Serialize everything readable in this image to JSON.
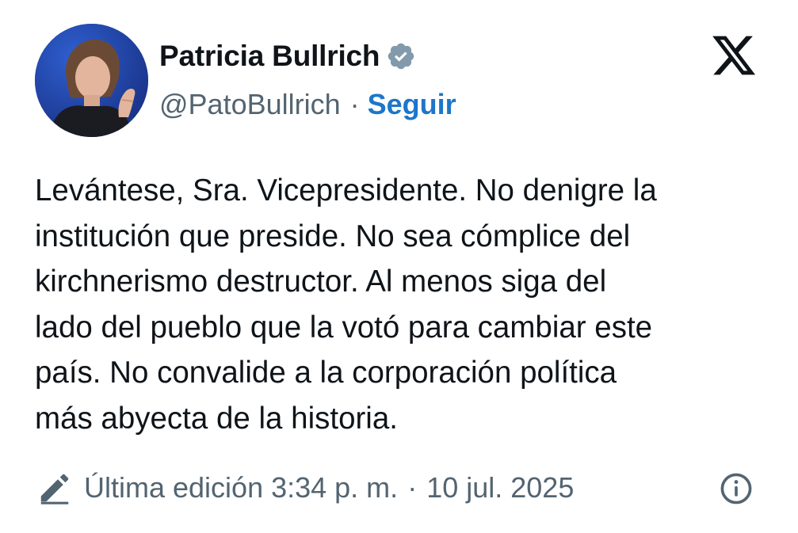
{
  "author": {
    "name": "Patricia Bullrich",
    "handle": "@PatoBullrich",
    "verified_icon": "verified-badge-icon",
    "avatar_icon": "profile-photo"
  },
  "header": {
    "separator": "·",
    "follow_label": "Seguir",
    "platform_logo": "x-logo-icon"
  },
  "tweet": {
    "text": "Levántese, Sra. Vicepresidente. No denigre la\ninstitución que preside. No sea cómplice del\nkirchnerismo destructor. Al menos siga del\nlado del pueblo que la votó para cambiar este\npaís. No convalide a la corporación política\nmás abyecta de la historia."
  },
  "footer": {
    "edit_icon": "pencil-icon",
    "edited_text": "Última edición 3:34 p. m.",
    "separator": "·",
    "date": "10 jul. 2025",
    "info_icon": "info-icon"
  },
  "colors": {
    "text": "#0f1419",
    "secondary": "#536471",
    "accent": "#1d76c9",
    "verified": "#829aab"
  }
}
